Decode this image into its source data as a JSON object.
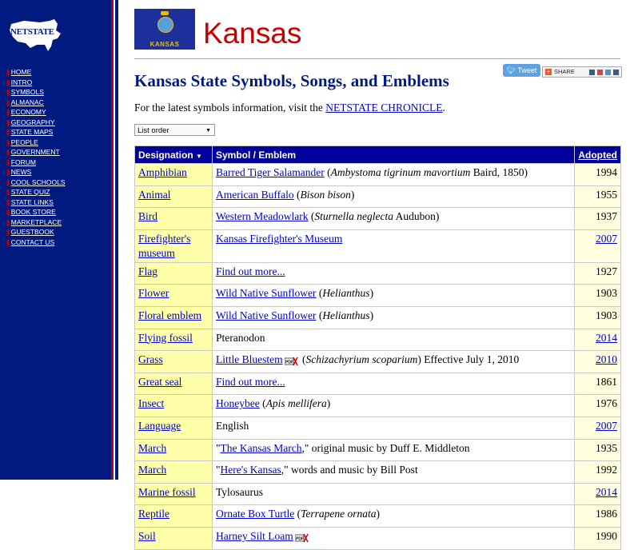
{
  "logo": {
    "text": "NETSTATE"
  },
  "nav": [
    "HOME",
    "INTRO",
    "SYMBOLS",
    "ALMANAC",
    "ECONOMY",
    "GEOGRAPHY",
    "STATE MAPS",
    "PEOPLE",
    "GOVERNMENT",
    "FORUM",
    "NEWS",
    "COOL SCHOOLS",
    "STATE QUIZ",
    "STATE LINKS",
    "BOOK STORE",
    "MARKETPLACE",
    "GUESTBOOK",
    "CONTACT US"
  ],
  "flag": {
    "label": "KANSAS"
  },
  "header": {
    "state_name": "Kansas"
  },
  "social": {
    "tweet": "Tweet",
    "share": "SHARE"
  },
  "page": {
    "title": "Kansas State Symbols, Songs, and Emblems",
    "intro_text": "For the latest symbols information, visit the ",
    "intro_link": "NETSTATE CHRONICLE",
    "intro_end": "."
  },
  "order_select": {
    "value": "List order"
  },
  "table": {
    "headers": {
      "designation": "Designation",
      "symbol": "Symbol / Emblem",
      "adopted": "Adopted"
    },
    "rows": [
      {
        "designation": "Amphibian",
        "symbol_link": "Barred Tiger Salamander",
        "symbol_rest": " (Ambystoma tigrinum mavortium Baird, 1850)",
        "year": "1994",
        "year_link": false
      },
      {
        "designation": "Animal",
        "symbol_link": "American Buffalo",
        "symbol_rest": " (Bison bison)",
        "year": "1955",
        "year_link": false
      },
      {
        "designation": "Bird",
        "symbol_link": "Western Meadowlark",
        "symbol_rest": " (Sturnella neglecta Audubon)",
        "year": "1937",
        "year_link": false
      },
      {
        "designation": "Firefighter's museum",
        "symbol_link": "Kansas Firefighter's Museum",
        "symbol_rest": "",
        "year": "2007",
        "year_link": true
      },
      {
        "designation": "Flag",
        "symbol_link": "Find out more...",
        "symbol_rest": "",
        "year": "1927",
        "year_link": false
      },
      {
        "designation": "Flower",
        "symbol_link": "Wild Native Sunflower",
        "symbol_rest": " (Helianthus)",
        "year": "1903",
        "year_link": false
      },
      {
        "designation": "Floral emblem",
        "symbol_link": "Wild Native Sunflower",
        "symbol_rest": " (Helianthus)",
        "year": "1903",
        "year_link": false
      },
      {
        "designation": "Flying fossil",
        "symbol_link": "",
        "symbol_rest": "Pteranodon",
        "year": "2014",
        "year_link": true
      },
      {
        "designation": "Grass",
        "symbol_link": "Little Bluestem",
        "symbol_rest": " (Schizachyrium scoparium) Effective July 1, 2010",
        "year": "2010",
        "year_link": true,
        "pdf": true
      },
      {
        "designation": "Great seal",
        "symbol_link": "Find out more...",
        "symbol_rest": "",
        "year": "1861",
        "year_link": false
      },
      {
        "designation": "Insect",
        "symbol_link": "Honeybee",
        "symbol_rest": " (Apis mellifera)",
        "year": "1976",
        "year_link": false
      },
      {
        "designation": "Language",
        "symbol_link": "",
        "symbol_rest": "English",
        "year": "2007",
        "year_link": true
      },
      {
        "designation": "March",
        "symbol_link": "The Kansas March",
        "symbol_rest": ",\" original music by Duff E. Middleton",
        "year": "1935",
        "year_link": false,
        "quoted": true
      },
      {
        "designation": "March",
        "symbol_link": "Here's Kansas",
        "symbol_rest": ",\" words and music by Bill Post",
        "year": "1992",
        "year_link": false,
        "quoted": true
      },
      {
        "designation": "Marine fossil",
        "symbol_link": "",
        "symbol_rest": "Tylosaurus",
        "year": "2014",
        "year_link": true
      },
      {
        "designation": "Reptile",
        "symbol_link": "Ornate Box Turtle",
        "symbol_rest": " (Terrapene ornata)",
        "year": "1986",
        "year_link": false
      },
      {
        "designation": "Soil",
        "symbol_link": "Harney Silt Loam",
        "symbol_rest": "",
        "year": "1990",
        "year_link": false,
        "pdf": true
      }
    ]
  }
}
